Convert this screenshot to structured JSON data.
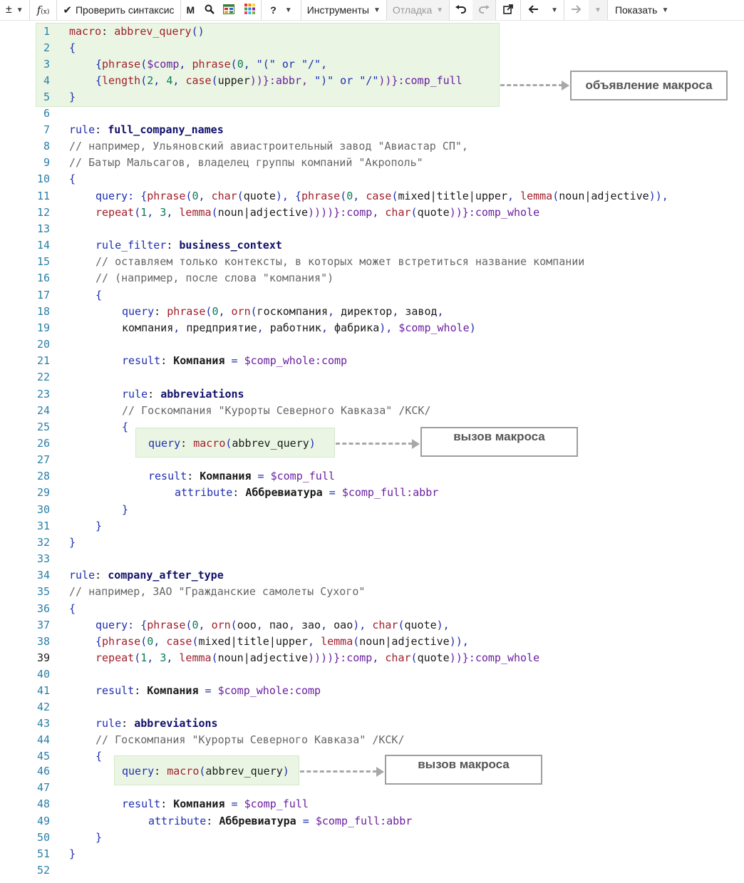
{
  "toolbar": {
    "add_label": "±",
    "fx_label": "f(x)",
    "check_syntax_label": "Проверить синтаксис",
    "m_label": "M",
    "help_label": "?",
    "tools_label": "Инструменты",
    "debug_label": "Отладка",
    "show_label": "Показать"
  },
  "callouts": {
    "macro_declaration": "объявление макроса",
    "macro_call_1": "вызов макроса",
    "macro_call_2": "вызов макроса"
  },
  "lines": {
    "l1": {
      "num": "1",
      "t1": "macro",
      "t2": ": ",
      "t3": "abbrev_query",
      "t4": "()"
    },
    "l2": {
      "num": "2",
      "t1": "{"
    },
    "l3": {
      "num": "3",
      "t1": "{",
      "t2": "phrase",
      "t3": "(",
      "t4": "$comp",
      "t5": ", ",
      "t6": "phrase",
      "t7": "(",
      "t8": "0",
      "t9": ", ",
      "t10": "\"(\" or \"/\"",
      "t11": ","
    },
    "l4": {
      "num": "4",
      "t1": "{",
      "t2": "length",
      "t3": "(",
      "t4": "2",
      "t5": ", ",
      "t6": "4",
      "t7": ", ",
      "t8": "case",
      "t9": "(",
      "t10": "upper",
      "t11": "))}:abbr, ",
      "t12": "\")\" or \"/\"",
      "t13": "))}:comp_full"
    },
    "l5": {
      "num": "5",
      "t1": "}"
    },
    "l6": {
      "num": "6"
    },
    "l7": {
      "num": "7",
      "t1": "rule",
      "t2": ": ",
      "t3": "full_company_names"
    },
    "l8": {
      "num": "8",
      "t1": "// например, Ульяновский авиастроительный завод \"Авиастар СП\","
    },
    "l9": {
      "num": "9",
      "t1": "// Батыр Мальсагов, владелец группы компаний \"Акрополь\""
    },
    "l10": {
      "num": "10",
      "t1": "{"
    },
    "l11": {
      "num": "11",
      "t1": "query",
      "t2": ": {",
      "t3": "phrase",
      "t4": "(",
      "t5": "0",
      "t6": ", ",
      "t7": "char",
      "t8": "(",
      "t9": "quote",
      "t10": "), {",
      "t11": "phrase",
      "t12": "(",
      "t13": "0",
      "t14": ", ",
      "t15": "case",
      "t16": "(",
      "t17": "mixed|title|upper",
      "t18": ", ",
      "t19": "lemma",
      "t20": "(",
      "t21": "noun|adjective",
      "t22": ")),"
    },
    "l12": {
      "num": "12",
      "t1": "repeat",
      "t2": "(",
      "t3": "1",
      "t4": ", ",
      "t5": "3",
      "t6": ", ",
      "t7": "lemma",
      "t8": "(",
      "t9": "noun|adjective",
      "t10": "))))}:comp, ",
      "t11": "char",
      "t12": "(",
      "t13": "quote",
      "t14": "))}:comp_whole"
    },
    "l13": {
      "num": "13"
    },
    "l14": {
      "num": "14",
      "t1": "rule_filter",
      "t2": ": ",
      "t3": "business_context"
    },
    "l15": {
      "num": "15",
      "t1": "// оставляем только контексты, в которых может встретиться название компании"
    },
    "l16": {
      "num": "16",
      "t1": "// (например, после слова \"компания\")"
    },
    "l17": {
      "num": "17",
      "t1": "{"
    },
    "l18": {
      "num": "18",
      "t1": "query",
      "t2": ": ",
      "t3": "phrase",
      "t4": "(",
      "t5": "0",
      "t6": ", ",
      "t7": "orn",
      "t8": "(",
      "t9": "госкомпания",
      "t10": ", ",
      "t11": "директор",
      "t12": ", ",
      "t13": "завод",
      "t14": ","
    },
    "l19": {
      "num": "19",
      "t1": "компания",
      "t2": ", ",
      "t3": "предприятие",
      "t4": ", ",
      "t5": "работник",
      "t6": ", ",
      "t7": "фабрика",
      "t8": "), ",
      "t9": "$comp_whole",
      "t10": ")"
    },
    "l20": {
      "num": "20"
    },
    "l21": {
      "num": "21",
      "t1": "result",
      "t2": ": ",
      "t3": "Компания",
      "t4": " = ",
      "t5": "$comp_whole:comp"
    },
    "l22": {
      "num": "22"
    },
    "l23": {
      "num": "23",
      "t1": "rule",
      "t2": ": ",
      "t3": "abbreviations"
    },
    "l24": {
      "num": "24",
      "t1": "// Госкомпания \"Курорты Северного Кавказа\" /КСК/"
    },
    "l25": {
      "num": "25",
      "t1": "{"
    },
    "l26": {
      "num": "26",
      "t1": "query",
      "t2": ": ",
      "t3": "macro",
      "t4": "(",
      "t5": "abbrev_query",
      "t6": ")"
    },
    "l27": {
      "num": "27"
    },
    "l28": {
      "num": "28",
      "t1": "result",
      "t2": ": ",
      "t3": "Компания",
      "t4": " = ",
      "t5": "$comp_full"
    },
    "l29": {
      "num": "29",
      "t1": "attribute",
      "t2": ": ",
      "t3": "Аббревиатура",
      "t4": " = ",
      "t5": "$comp_full:abbr"
    },
    "l30": {
      "num": "30",
      "t1": "}"
    },
    "l31": {
      "num": "31",
      "t1": "}"
    },
    "l32": {
      "num": "32",
      "t1": "}"
    },
    "l33": {
      "num": "33"
    },
    "l34": {
      "num": "34",
      "t1": "rule",
      "t2": ": ",
      "t3": "company_after_type"
    },
    "l35": {
      "num": "35",
      "t1": "// например, ЗАО \"Гражданские самолеты Сухого\""
    },
    "l36": {
      "num": "36",
      "t1": "{"
    },
    "l37": {
      "num": "37",
      "t1": "query",
      "t2": ": {",
      "t3": "phrase",
      "t4": "(",
      "t5": "0",
      "t6": ", ",
      "t7": "orn",
      "t8": "(",
      "t9": "ооо",
      "t10": ", ",
      "t11": "пао",
      "t12": ", ",
      "t13": "зао",
      "t14": ", ",
      "t15": "оао",
      "t16": "), ",
      "t17": "char",
      "t18": "(",
      "t19": "quote",
      "t20": "),"
    },
    "l38": {
      "num": "38",
      "t1": "{",
      "t2": "phrase",
      "t3": "(",
      "t4": "0",
      "t5": ", ",
      "t6": "case",
      "t7": "(",
      "t8": "mixed|title|upper",
      "t9": ", ",
      "t10": "lemma",
      "t11": "(",
      "t12": "noun|adjective",
      "t13": ")),"
    },
    "l39": {
      "num": "39",
      "t1": "repeat",
      "t2": "(",
      "t3": "1",
      "t4": ", ",
      "t5": "3",
      "t6": ", ",
      "t7": "lemma",
      "t8": "(",
      "t9": "noun|adjective",
      "t10": "))))}:comp, ",
      "t11": "char",
      "t12": "(",
      "t13": "quote",
      "t14": "))}:comp_whole"
    },
    "l40": {
      "num": "40"
    },
    "l41": {
      "num": "41",
      "t1": "result",
      "t2": ": ",
      "t3": "Компания",
      "t4": " = ",
      "t5": "$comp_whole:comp"
    },
    "l42": {
      "num": "42"
    },
    "l43": {
      "num": "43",
      "t1": "rule",
      "t2": ": ",
      "t3": "abbreviations"
    },
    "l44": {
      "num": "44",
      "t1": "// Госкомпания \"Курорты Северного Кавказа\" /КСК/"
    },
    "l45": {
      "num": "45",
      "t1": "{"
    },
    "l46": {
      "num": "46",
      "t1": "query",
      "t2": ": ",
      "t3": "macro",
      "t4": "(",
      "t5": "abbrev_query",
      "t6": ")"
    },
    "l47": {
      "num": "47"
    },
    "l48": {
      "num": "48",
      "t1": "result",
      "t2": ": ",
      "t3": "Компания",
      "t4": " = ",
      "t5": "$comp_full"
    },
    "l49": {
      "num": "49",
      "t1": "attribute",
      "t2": ": ",
      "t3": "Аббревиатура",
      "t4": " = ",
      "t5": "$comp_full:abbr"
    },
    "l50": {
      "num": "50",
      "t1": "}"
    },
    "l51": {
      "num": "51",
      "t1": "}"
    },
    "l52": {
      "num": "52"
    }
  }
}
